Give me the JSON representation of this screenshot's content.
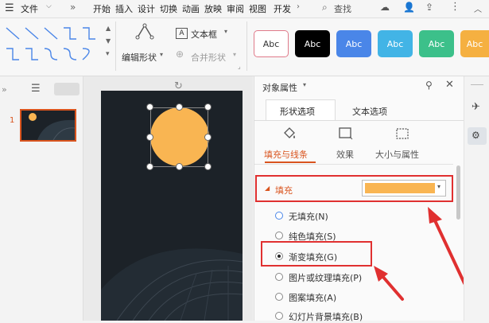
{
  "menubar": {
    "file_label": "文件",
    "items": [
      "开始",
      "插入",
      "设计",
      "切换",
      "动画",
      "放映",
      "审阅",
      "视图",
      "开发"
    ],
    "search_label": "查找"
  },
  "ribbon": {
    "edit_shape_label": "编辑形状",
    "textbox_label": "文本框",
    "merge_shape_label": "合并形状",
    "style_buttons": [
      {
        "label": "Abc",
        "bg": "#ffffff",
        "fg": "#333333",
        "border": "#e07a8a"
      },
      {
        "label": "Abc",
        "bg": "#000000",
        "fg": "#ffffff",
        "border": "#000000"
      },
      {
        "label": "Abc",
        "bg": "#4a86e8",
        "fg": "#ffffff",
        "border": "#4a86e8"
      },
      {
        "label": "Abc",
        "bg": "#42b4e6",
        "fg": "#ffffff",
        "border": "#42b4e6"
      },
      {
        "label": "Abc",
        "bg": "#3cc08a",
        "fg": "#ffffff",
        "border": "#3cc08a"
      },
      {
        "label": "Abc",
        "bg": "#f5b041",
        "fg": "#ffffff",
        "border": "#f5b041"
      }
    ]
  },
  "thumbs": {
    "slide_number": "1"
  },
  "panel": {
    "title": "对象属性",
    "tab_shape": "形状选项",
    "tab_text": "文本选项",
    "subtab_fill": "填充与线条",
    "subtab_effect": "效果",
    "subtab_size": "大小与属性",
    "fill_section": "填充",
    "fill_color": "#f9b552",
    "options": [
      "无填充(N)",
      "纯色填充(S)",
      "渐变填充(G)",
      "图片或纹理填充(P)",
      "图案填充(A)",
      "幻灯片背景填充(B)"
    ],
    "selected_option_index": 2
  },
  "colors": {
    "accent": "#d9541e",
    "highlight": "#e03030",
    "shape_fill": "#f9b552",
    "slide_bg": "#1c2228"
  }
}
